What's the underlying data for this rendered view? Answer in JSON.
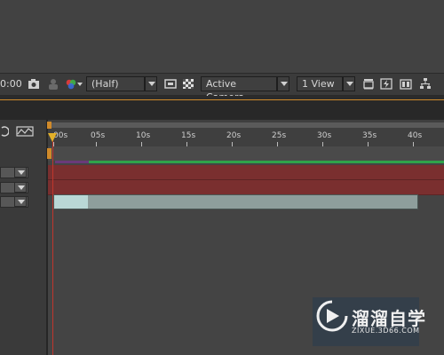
{
  "viewer_toolbar": {
    "timecode": "0:00",
    "resolution": "(Half)",
    "camera": "Active Camera",
    "views": "1 View"
  },
  "timeline": {
    "ticks": [
      "00s",
      "05s",
      "10s",
      "15s",
      "20s",
      "25s",
      "30s",
      "35s",
      "40s"
    ],
    "playhead_time": "00s"
  },
  "watermark": {
    "title": "溜溜自学",
    "url": "ZIXUE.3D66.COM"
  },
  "colors": {
    "layer_red": "#7a2f2f",
    "playhead": "#c0362c",
    "green_bar": "#2fa34a",
    "marker": "#e3b028"
  }
}
